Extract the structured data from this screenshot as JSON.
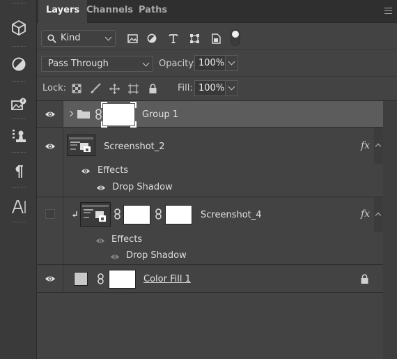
{
  "tabs": [
    "Layers",
    "Channels",
    "Paths"
  ],
  "active_tab": "Layers",
  "filter": {
    "kind_label": "Kind",
    "icons": [
      "pixel-filter-icon",
      "adjustment-filter-icon",
      "type-filter-icon",
      "shape-filter-icon",
      "smart-object-filter-icon"
    ]
  },
  "blend": {
    "mode": "Pass Through",
    "opacity_label": "Opacity:",
    "opacity_value": "100%"
  },
  "lock": {
    "label": "Lock:",
    "fill_label": "Fill:",
    "fill_value": "100%"
  },
  "tools": [
    "3d-cube-icon",
    "color-adjust-icon",
    "image-library-icon",
    "paragraph-style-icon",
    "paragraph-icon",
    "character-icon"
  ],
  "layers": [
    {
      "name": "Group 1",
      "type": "group",
      "visible": true,
      "selected": true
    },
    {
      "name": "Screenshot_2",
      "type": "smart-object",
      "visible": true,
      "fx": "fx",
      "effects_label": "Effects",
      "effects": [
        "Drop Shadow"
      ]
    },
    {
      "name": "Screenshot_4",
      "type": "clipped-smart-object",
      "visible": false,
      "fx": "fx",
      "effects_label": "Effects",
      "effects": [
        "Drop Shadow"
      ]
    },
    {
      "name": "Color Fill 1",
      "type": "fill",
      "visible": true,
      "locked": true
    }
  ],
  "colors": {
    "panel_bg": "#434343",
    "tab_bar": "#2f2f2f",
    "selected_layer": "#5c5c5c",
    "fill_swatch": "#c8c8c8"
  }
}
